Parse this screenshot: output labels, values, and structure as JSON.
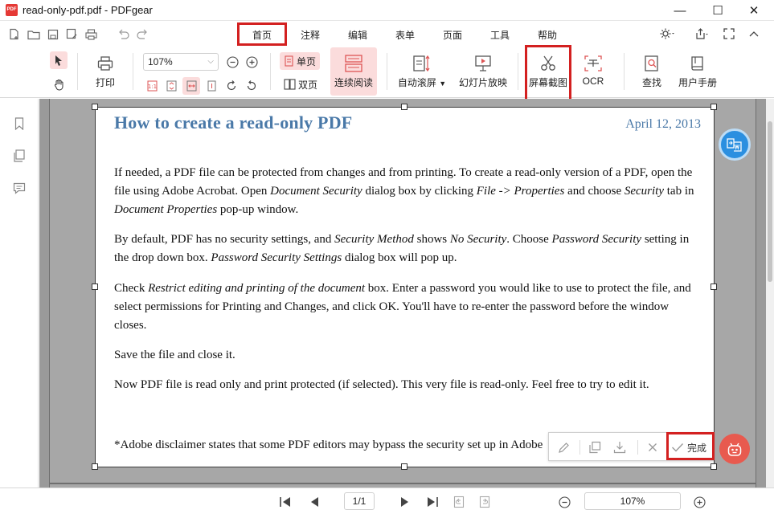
{
  "window": {
    "logo_text": "PDF",
    "title": "read-only-pdf.pdf - PDFgear",
    "minimize": "—",
    "maximize": "☐",
    "close": "✕"
  },
  "menu": {
    "tabs": [
      {
        "label": "首页",
        "active": true
      },
      {
        "label": "注释"
      },
      {
        "label": "编辑"
      },
      {
        "label": "表单"
      },
      {
        "label": "页面"
      },
      {
        "label": "工具"
      },
      {
        "label": "帮助"
      }
    ]
  },
  "ribbon": {
    "print_label": "打印",
    "zoom_value": "107%",
    "single_page_label": "单页",
    "double_page_label": "双页",
    "continuous_label": "连续阅读",
    "auto_scroll_label": "自动滚屏",
    "slideshow_label": "幻灯片放映",
    "screenshot_label": "屏幕截图",
    "ocr_label": "OCR",
    "find_label": "查找",
    "manual_label": "用户手册"
  },
  "document": {
    "title": "How to create a read-only PDF",
    "date": "April 12, 2013",
    "p1": [
      "If needed, a PDF file can be protected from changes and from printing. To create a read-only version of a PDF, open the file using Adobe Acrobat. Open ",
      "Document Security",
      " dialog box by clicking ",
      "File -> Properties",
      " and choose ",
      "Security",
      " tab in ",
      "Document Properties",
      " pop-up window."
    ],
    "p2": [
      "By default, PDF has no security settings, and ",
      "Security Method",
      " shows ",
      "No Security",
      ". Choose ",
      "Password Security",
      " setting in the drop down box. ",
      "Password Security Settings",
      " dialog box will pop up."
    ],
    "p3": [
      "Check ",
      "Restrict editing and printing of the document",
      " box. Enter a password you would like to use to protect the file, and select permissions for Printing and Changes, and click OK. You'll have to re-enter the password before the window closes."
    ],
    "p4": "Save the file and close it.",
    "p5": "Now PDF file is read only and print protected (if selected). This very file is read-only. Feel free to try to edit it.",
    "p6": "*Adobe disclaimer states that some PDF editors may bypass the security set up in Adobe"
  },
  "capture_toolbar": {
    "done_label": "完成"
  },
  "status": {
    "page_indicator": "1/1",
    "zoom": "107%"
  },
  "colors": {
    "accent_red": "#d32020",
    "title_blue": "#4a79a8",
    "convert_blue": "#2b8fe0",
    "bot_red": "#e85a4f"
  }
}
